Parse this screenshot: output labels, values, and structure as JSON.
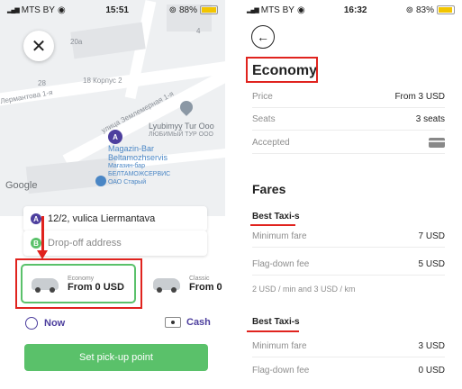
{
  "left": {
    "status": {
      "carrier": "MTS BY",
      "time": "15:51",
      "battery": "88%"
    },
    "map": {
      "streets": [
        "20а",
        "28",
        "18 Корпус 2",
        "Лермантова 1-я",
        "улица Лермантова",
        "улица Землемерная 1-я",
        "4"
      ],
      "poi1": {
        "name": "Lyubimyy Tur Ooo",
        "sub": "ЛЮБИМЫЙ ТУР ООО"
      },
      "poi2": {
        "name": "Magazin-Bar",
        "name2": "Beltamozhservis",
        "sub1": "Магазин-бар",
        "sub2": "БЕЛТАМОЖСЕРВИС",
        "sub3": "ОАО Старый"
      },
      "google": "Google"
    },
    "pickup": {
      "marker": "A",
      "address": "12/2, vulica Liermantava"
    },
    "dropoff": {
      "marker": "B",
      "placeholder": "Drop-off address"
    },
    "tariffs": [
      {
        "small": "Economy",
        "price": "From 0 USD"
      },
      {
        "small": "Classic",
        "price": "From 0"
      }
    ],
    "when": "Now",
    "payment": "Cash",
    "cta": "Set pick-up point",
    "colors": {
      "accent": "#5ac16a",
      "highlight": "#e0231e"
    }
  },
  "right": {
    "status": {
      "carrier": "MTS BY",
      "time": "16:32",
      "battery": "83%"
    },
    "title": "Economy",
    "info": [
      {
        "key": "Price",
        "value": "From 3 USD"
      },
      {
        "key": "Seats",
        "value": "3 seats"
      },
      {
        "key": "Accepted",
        "value": ""
      }
    ],
    "fares_title": "Fares",
    "fare_groups": [
      {
        "name": "Best Taxi-s",
        "rows": [
          {
            "key": "Minimum fare",
            "value": "7 USD"
          },
          {
            "key": "Flag-down fee",
            "value": "5 USD"
          }
        ],
        "note": "2 USD / min and 3 USD / km"
      },
      {
        "name": "Best Taxi-s",
        "rows": [
          {
            "key": "Minimum fare",
            "value": "3 USD"
          },
          {
            "key": "Flag-down fee",
            "value": "0 USD"
          }
        ]
      }
    ]
  }
}
